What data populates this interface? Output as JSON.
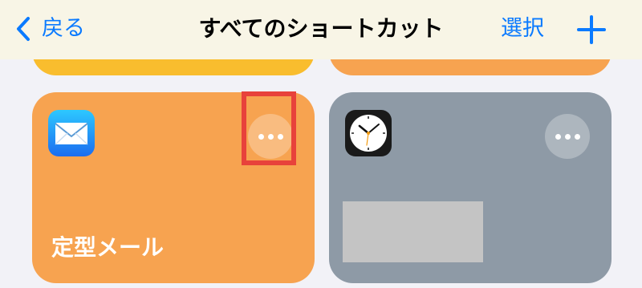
{
  "navbar": {
    "back_label": "戻る",
    "title": "すべてのショートカット",
    "select_label": "選択",
    "add_icon": "plus-icon",
    "accent_color": "#0a7aff"
  },
  "shortcuts": [
    {
      "label": "定型メール",
      "icon": "mail-icon",
      "color": "#f7a350"
    },
    {
      "label": "",
      "icon": "clock-icon",
      "color": "#8e9aa6"
    }
  ],
  "annotation": {
    "highlight_color": "#e8423b",
    "target": "more-options-button"
  }
}
